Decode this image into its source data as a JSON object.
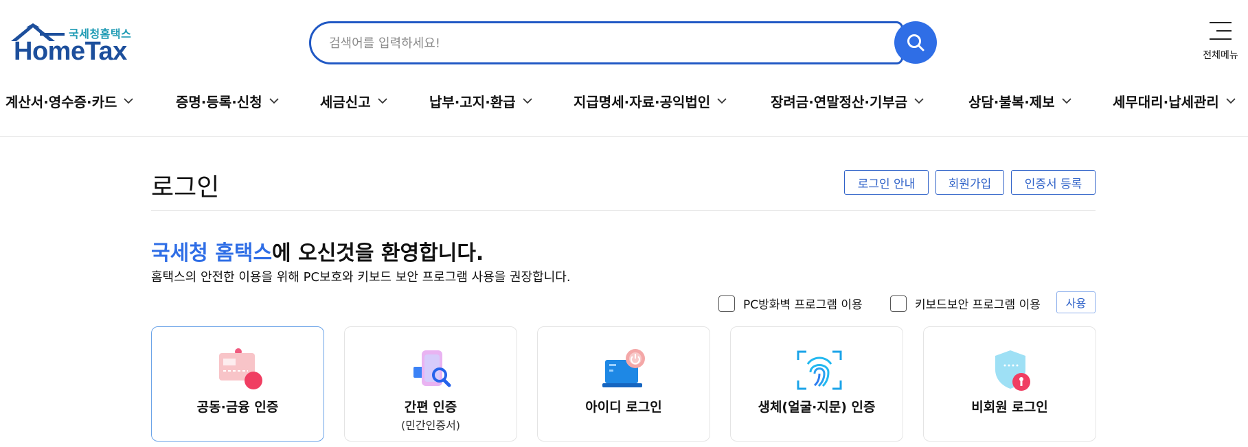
{
  "header": {
    "logo_small": "국세청홈택스",
    "logo_big": "HomeTax",
    "search_placeholder": "검색어를 입력하세요!",
    "search_value": "",
    "menu_all_label": "전체메뉴",
    "brand_color": "#2f6ee6"
  },
  "gnb": {
    "items": [
      {
        "label": "계산서·영수증·카드"
      },
      {
        "label": "증명·등록·신청"
      },
      {
        "label": "세금신고"
      },
      {
        "label": "납부·고지·환급"
      },
      {
        "label": "지급명세·자료·공익법인"
      },
      {
        "label": "장려금·연말정산·기부금"
      },
      {
        "label": "상담·불복·제보"
      },
      {
        "label": "세무대리·납세관리"
      }
    ]
  },
  "login": {
    "title": "로그인",
    "top_buttons": {
      "guide": "로그인 안내",
      "signup": "회원가입",
      "cert_register": "인증서 등록"
    },
    "welcome_highlight": "국세청 홈택스",
    "welcome_rest": "에 오신것을 환영합니다.",
    "subtext": "홈택스의 안전한 이용을 위해 PC보호와 키보드 보안 프로그램 사용을 권장합니다.",
    "options": {
      "firewall_label": "PC방화벽 프로그램 이용",
      "firewall_checked": false,
      "keyboard_label": "키보드보안 프로그램 이용",
      "keyboard_checked": false,
      "use_button": "사용"
    },
    "methods": [
      {
        "label": "공동·금융 인증",
        "sub": "",
        "icon": "certificate-card-icon",
        "selected": true
      },
      {
        "label": "간편 인증",
        "sub": "(민간인증서)",
        "icon": "mobile-search-icon",
        "selected": false
      },
      {
        "label": "아이디 로그인",
        "sub": "",
        "icon": "laptop-power-icon",
        "selected": false
      },
      {
        "label": "생체(얼굴·지문) 인증",
        "sub": "",
        "icon": "fingerprint-icon",
        "selected": false
      },
      {
        "label": "비회원 로그인",
        "sub": "",
        "icon": "shield-lock-icon",
        "selected": false
      }
    ]
  }
}
